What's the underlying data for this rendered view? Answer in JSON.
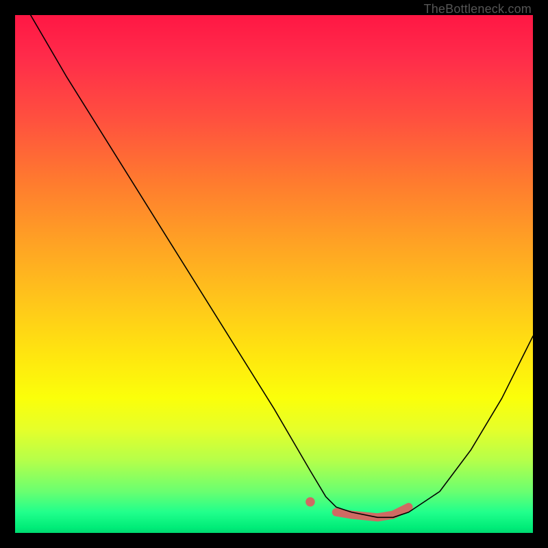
{
  "watermark": "TheBottleneck.com",
  "colors": {
    "page_bg": "#000000",
    "curve": "#000000",
    "marker": "#cf6a63",
    "watermark": "#555555",
    "gradient_top": "#ff1744",
    "gradient_mid": "#ffe70f",
    "gradient_bottom": "#00d870"
  },
  "chart_data": {
    "type": "line",
    "title": "",
    "xlabel": "",
    "ylabel": "",
    "xlim": [
      0,
      100
    ],
    "ylim": [
      0,
      100
    ],
    "grid": false,
    "legend": false,
    "series": [
      {
        "name": "bottleneck-curve",
        "x": [
          3,
          10,
          20,
          30,
          40,
          50,
          57,
          60,
          62,
          65,
          70,
          73,
          76,
          82,
          88,
          94,
          100
        ],
        "values": [
          100,
          88,
          72,
          56,
          40,
          24,
          12,
          7,
          5,
          4,
          3,
          3,
          4,
          8,
          16,
          26,
          38
        ]
      }
    ],
    "markers": {
      "name": "highlight-band",
      "color": "#cf6a63",
      "points": [
        {
          "x": 57,
          "y": 6
        },
        {
          "x": 62,
          "y": 4
        },
        {
          "x": 65,
          "y": 3.5
        },
        {
          "x": 70,
          "y": 3
        },
        {
          "x": 73,
          "y": 3.5
        },
        {
          "x": 76,
          "y": 5
        }
      ]
    }
  }
}
